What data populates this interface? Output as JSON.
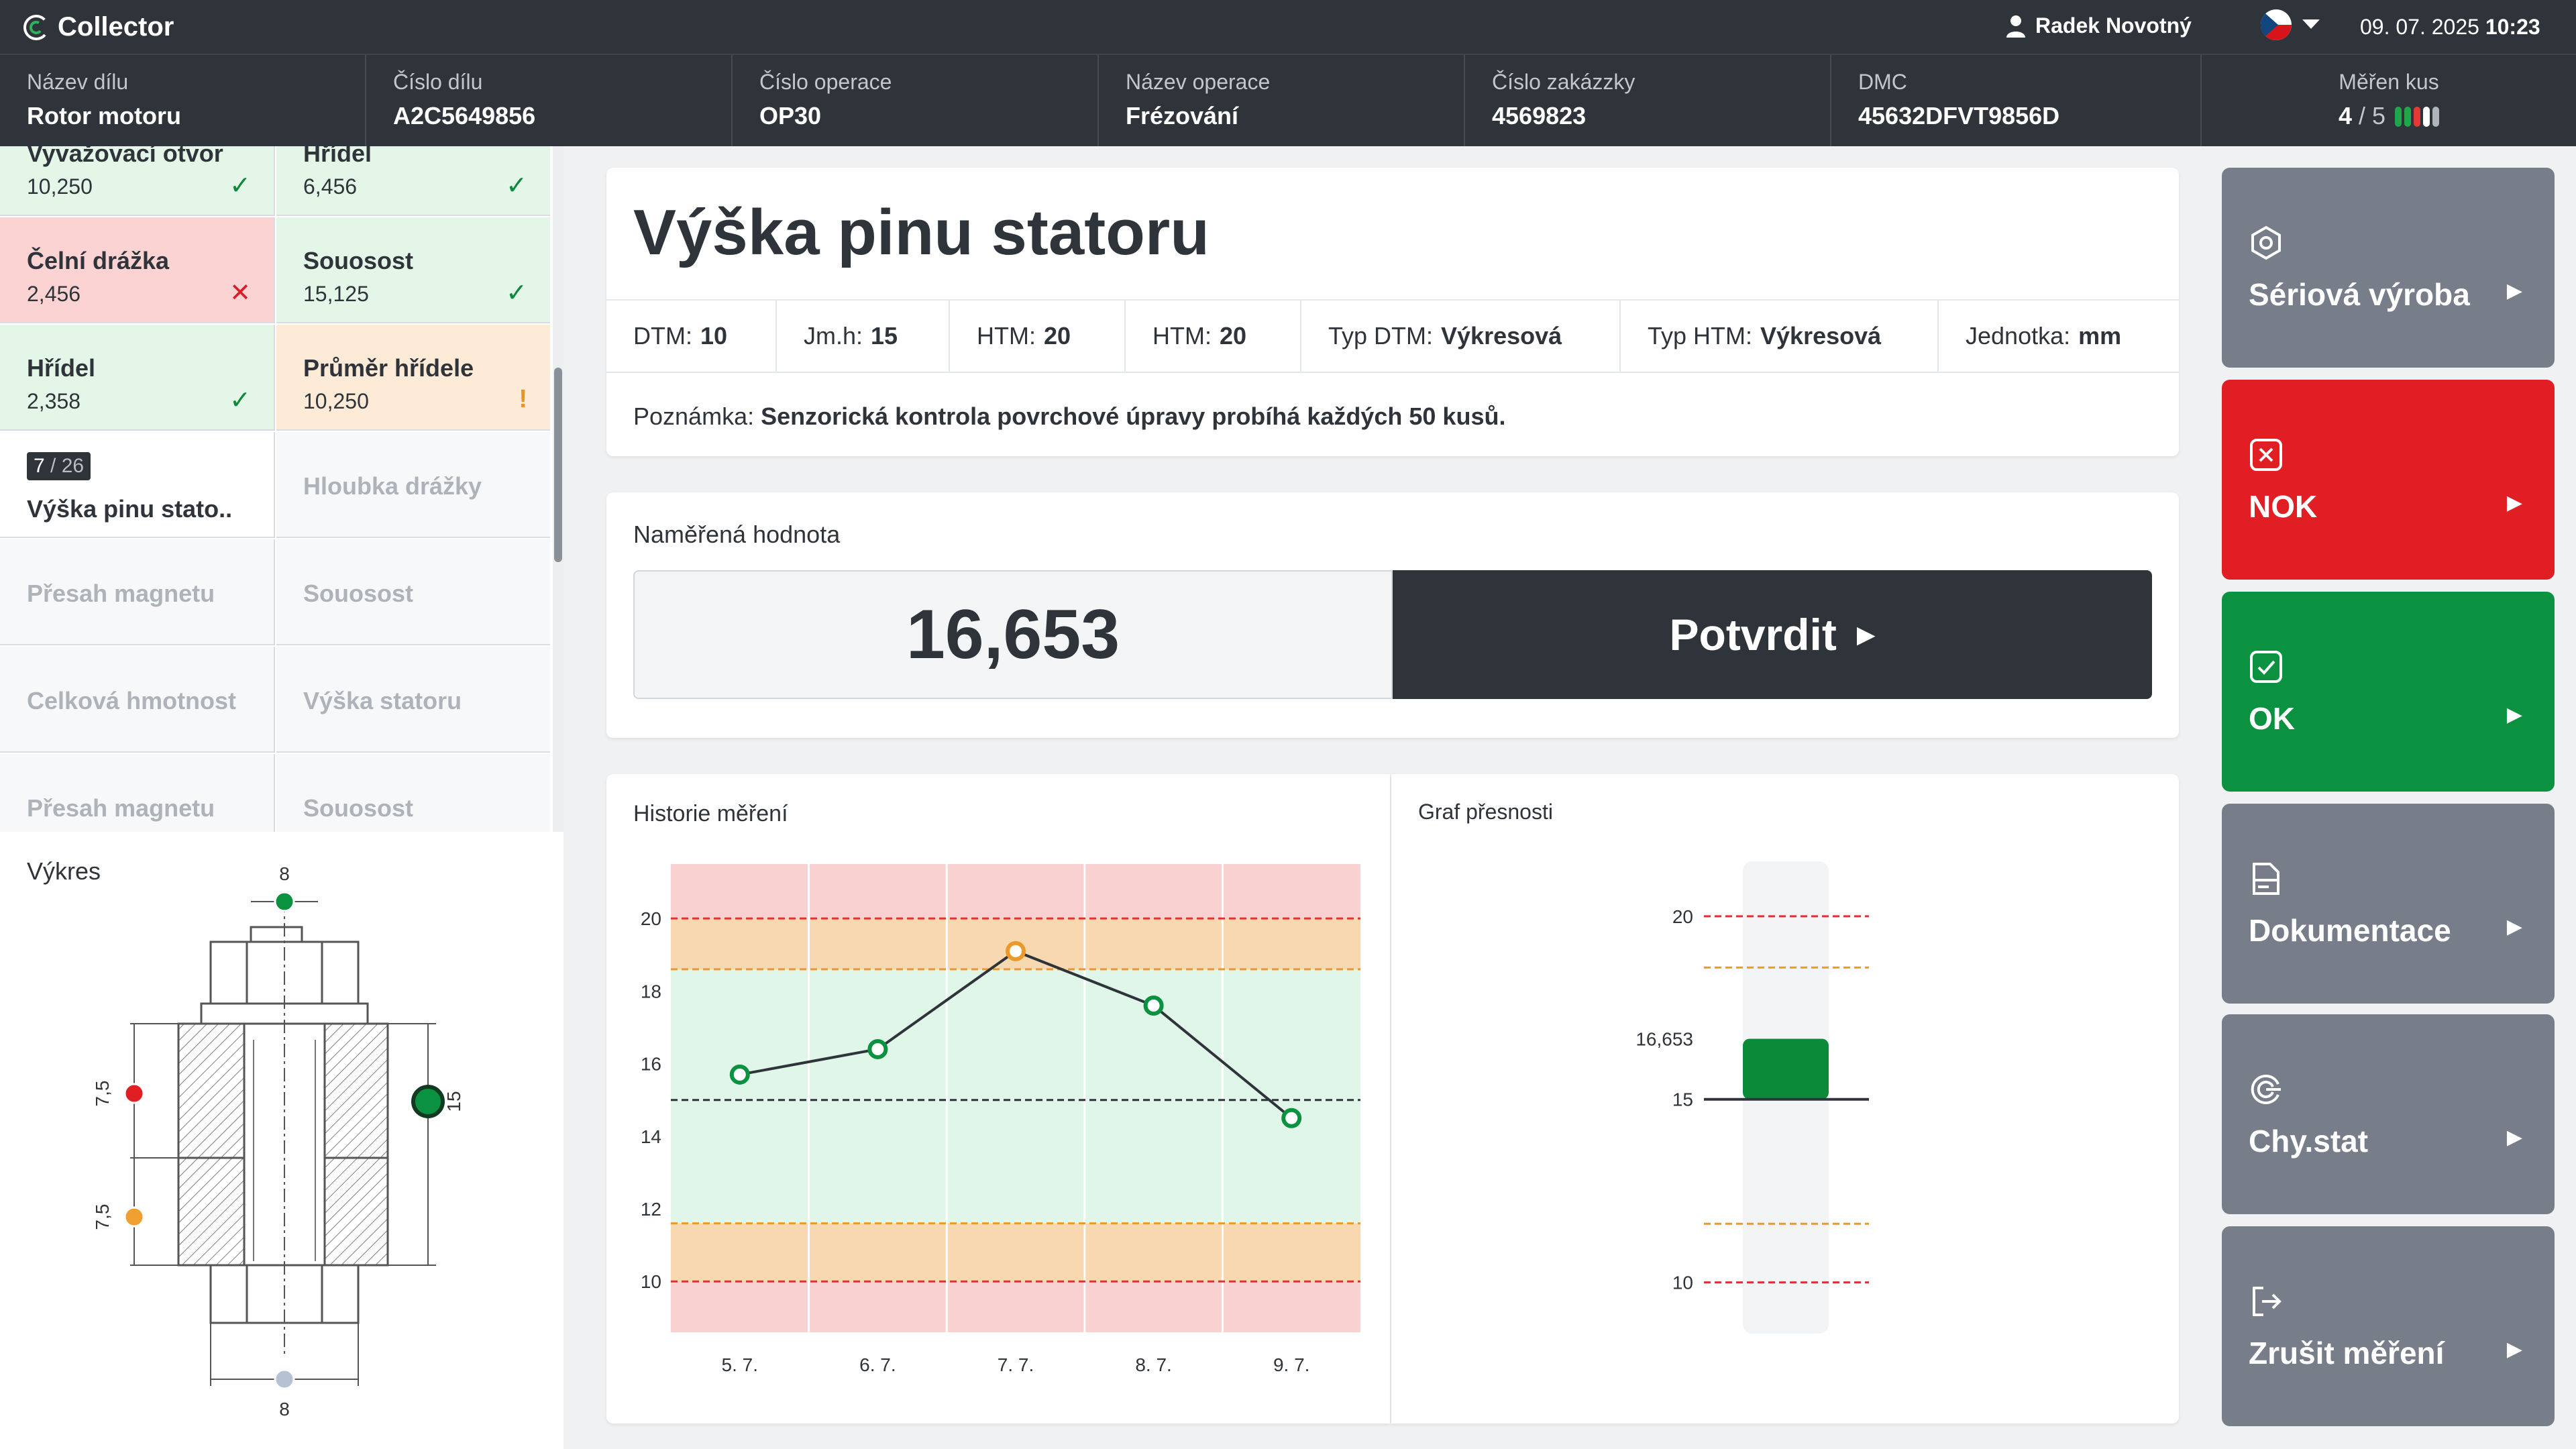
{
  "app": {
    "name": "Collector"
  },
  "user": {
    "name": "Radek Novotný"
  },
  "header": {
    "date": "09. 07. 2025",
    "time": "10:23"
  },
  "info": [
    {
      "label": "Název dílu",
      "value": "Rotor motoru"
    },
    {
      "label": "Číslo dílu",
      "value": "A2C5649856"
    },
    {
      "label": "Číslo operace",
      "value": "OP30"
    },
    {
      "label": "Název operace",
      "value": "Frézování"
    },
    {
      "label": "Číslo zakázzky",
      "value": "4569823"
    },
    {
      "label": "DMC",
      "value": "45632DFVT9856D"
    }
  ],
  "measured_pieces": {
    "label": "Měřen kus",
    "current": "4",
    "total": "5",
    "status_colors": [
      "#1fa64a",
      "#1fa64a",
      "#e53935",
      "#ffffff",
      "#b0b5bb"
    ]
  },
  "characteristics": [
    {
      "name": "Vyvažovací otvor",
      "value": "10,250",
      "status": "ok",
      "mark": "✓"
    },
    {
      "name": "Hřídel",
      "value": "6,456",
      "status": "ok",
      "mark": "✓"
    },
    {
      "name": "Čelní drážka",
      "value": "2,456",
      "status": "nok",
      "mark": "✕"
    },
    {
      "name": "Souosost",
      "value": "15,125",
      "status": "ok",
      "mark": "✓"
    },
    {
      "name": "Hřídel",
      "value": "2,358",
      "status": "ok",
      "mark": "✓"
    },
    {
      "name": "Průměr hřídele",
      "value": "10,250",
      "status": "warn",
      "mark": "!"
    },
    {
      "name": "Výška pinu stato..",
      "index": "7",
      "total": "/ 26",
      "status": "current"
    },
    {
      "name": "Hloubka drážky",
      "status": "pending"
    },
    {
      "name": "Přesah magnetu",
      "status": "pending"
    },
    {
      "name": "Souosost",
      "status": "pending"
    },
    {
      "name": "Celková hmotnost",
      "status": "pending"
    },
    {
      "name": "Výška statoru",
      "status": "pending"
    },
    {
      "name": "Přesah magnetu",
      "status": "pending"
    },
    {
      "name": "Souosost",
      "status": "pending"
    }
  ],
  "drawing": {
    "title": "Výkres",
    "dims": {
      "top": "8",
      "bottom": "8",
      "right": "15",
      "left_upper": "7,5",
      "left_lower": "7,5"
    }
  },
  "feature": {
    "title": "Výška pinu statoru",
    "params": [
      {
        "label": "DTM:",
        "value": "10"
      },
      {
        "label": "Jm.h:",
        "value": "15"
      },
      {
        "label": "HTM:",
        "value": "20"
      },
      {
        "label": "HTM:",
        "value": "20"
      },
      {
        "label": "Typ DTM:",
        "value": "Výkresová"
      },
      {
        "label": "Typ HTM:",
        "value": "Výkresová"
      },
      {
        "label": "Jednotka:",
        "value": "mm"
      }
    ],
    "note_label": "Poznámka:",
    "note": "Senzorická kontrola povrchové úpravy probíhá každých 50 kusů."
  },
  "measurement": {
    "label": "Naměřená hodnota",
    "value": "16,653",
    "confirm_label": "Potvrdit"
  },
  "chart_data": [
    {
      "type": "line",
      "title": "Historie měření",
      "x": [
        "5. 7.",
        "6. 7.",
        "7. 7.",
        "8. 7.",
        "9. 7."
      ],
      "series": [
        {
          "values": [
            15.7,
            16.4,
            19.1,
            17.6,
            14.5
          ]
        }
      ],
      "point_status": [
        "ok",
        "ok",
        "warn",
        "ok",
        "ok"
      ],
      "y_ticks": [
        10,
        12,
        14,
        16,
        18,
        20
      ],
      "ylim": [
        8.6,
        21.5
      ],
      "limits": {
        "lower_tolerance": 10,
        "lower_warning": 11.6,
        "nominal": 15,
        "upper_warning": 18.6,
        "upper_tolerance": 20
      },
      "zones": {
        "red": "#f9d1d1",
        "orange": "#f8d8b0",
        "green": "#e0f6e8"
      }
    },
    {
      "type": "bar",
      "title": "Graf přesnosti",
      "values": [
        16.653
      ],
      "value_label": "16,653",
      "y_ticks": [
        10,
        15,
        20
      ],
      "ylim": [
        8.6,
        21.5
      ],
      "limits": {
        "lower_tolerance": 10,
        "lower_warning": 11.6,
        "nominal": 15,
        "upper_warning": 18.6,
        "upper_tolerance": 20
      }
    }
  ],
  "actions": [
    {
      "label": "Sériová výroba",
      "icon": "serial-production-icon",
      "color": "#777e89"
    },
    {
      "label": "NOK",
      "icon": "x-square-icon",
      "color": "#e01e23"
    },
    {
      "label": "OK",
      "icon": "check-square-icon",
      "color": "#0b9240"
    },
    {
      "label": "Dokumentace",
      "icon": "document-icon",
      "color": "#777e89"
    },
    {
      "label": "Chy.stat",
      "icon": "error-stats-icon",
      "color": "#777e89"
    },
    {
      "label": "Zrušit měření",
      "icon": "logout-icon",
      "color": "#777e89"
    }
  ]
}
